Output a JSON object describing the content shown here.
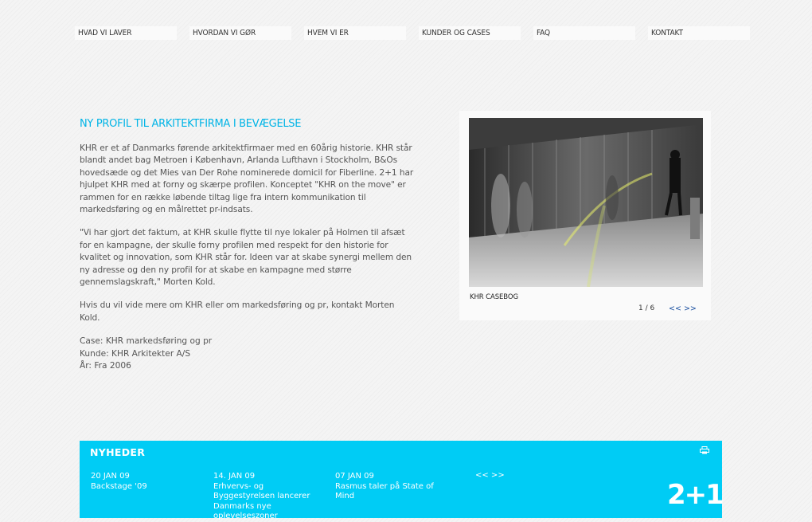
{
  "nav": {
    "items": [
      {
        "label": "HVAD VI LAVER"
      },
      {
        "label": "HVORDAN VI GØR"
      },
      {
        "label": "HVEM VI ER"
      },
      {
        "label": "KUNDER OG CASES"
      },
      {
        "label": "FAQ"
      },
      {
        "label": "KONTAKT"
      }
    ]
  },
  "article": {
    "title": "NY PROFIL TIL ARKITEKTFIRMA I BEVÆGELSE",
    "paragraphs": [
      "KHR er et af Danmarks førende arkitektfirmaer med en 60årig historie. KHR står blandt andet bag Metroen i København, Arlanda Lufthavn i Stockholm, B&Os hovedsæde og det Mies van Der Rohe nominerede domicil for Fiberline. 2+1 har hjulpet KHR med at forny og skærpe profilen. Konceptet \"KHR on the move\" er rammen for en række løbende tiltag lige fra intern kommunikation til markedsføring og en målrettet pr-indsats.",
      "\"Vi har gjort det faktum, at KHR skulle flytte til nye lokaler på Holmen til afsæt for en kampagne, der skulle forny profilen med respekt for den historie for kvalitet og innovation, som KHR står for. Ideen var at skabe synergi mellem den ny adresse og den ny profil for at skabe en kampagne med større gennemslagskraft,\"  Morten Kold.",
      "Hvis du vil vide mere om KHR eller om markedsføring og pr, kontakt Morten Kold."
    ],
    "meta": [
      "Case: KHR markedsføring og pr",
      "Kunde: KHR Arkitekter A/S",
      "År: Fra 2006"
    ]
  },
  "casebox": {
    "label": "KHR CASEBOG",
    "pager": "1 / 6",
    "arrows": "<< >>"
  },
  "news": {
    "title": "NYHEDER",
    "items": [
      {
        "date": "20 JAN 09",
        "text": "Backstage '09"
      },
      {
        "date": "14. JAN 09",
        "text": "Erhvervs- og Byggestyrelsen lancerer Danmarks nye oplevelseszoner"
      },
      {
        "date": "07 JAN 09",
        "text": "Rasmus taler på State of Mind"
      }
    ],
    "arrows": "<< >>",
    "logo": "2+1"
  },
  "colors": {
    "accent": "#00b4e6",
    "news_bar": "#00ccf5",
    "link": "#1a4fa0"
  }
}
